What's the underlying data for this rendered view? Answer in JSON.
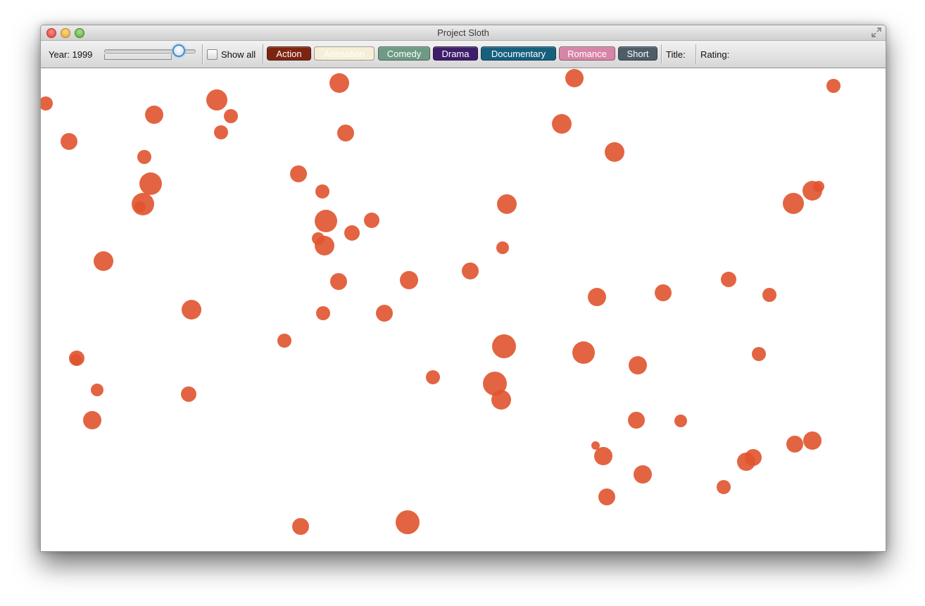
{
  "window": {
    "title": "Project Sloth"
  },
  "toolbar": {
    "year_label": "Year: 1999",
    "year_value": 1999,
    "show_all_label": "Show all",
    "show_all_checked": false,
    "genres": [
      {
        "label": "Action",
        "color": "#7d2411",
        "text_color": "#ffffff"
      },
      {
        "label": "Animation",
        "color": "#f6efd6",
        "text_color": "#ffffff"
      },
      {
        "label": "Comedy",
        "color": "#6e9a86",
        "text_color": "#ffffff"
      },
      {
        "label": "Drama",
        "color": "#3e1e6a",
        "text_color": "#ffffff"
      },
      {
        "label": "Documentary",
        "color": "#16607d",
        "text_color": "#ffffff"
      },
      {
        "label": "Romance",
        "color": "#d785a6",
        "text_color": "#ffffff"
      },
      {
        "label": "Short",
        "color": "#4e5c68",
        "text_color": "#ffffff"
      }
    ],
    "title_label": "Title:",
    "rating_label": "Rating:"
  },
  "visualization": {
    "bubble_color": "#e0532d",
    "bubble_opacity": 0.9
  }
}
